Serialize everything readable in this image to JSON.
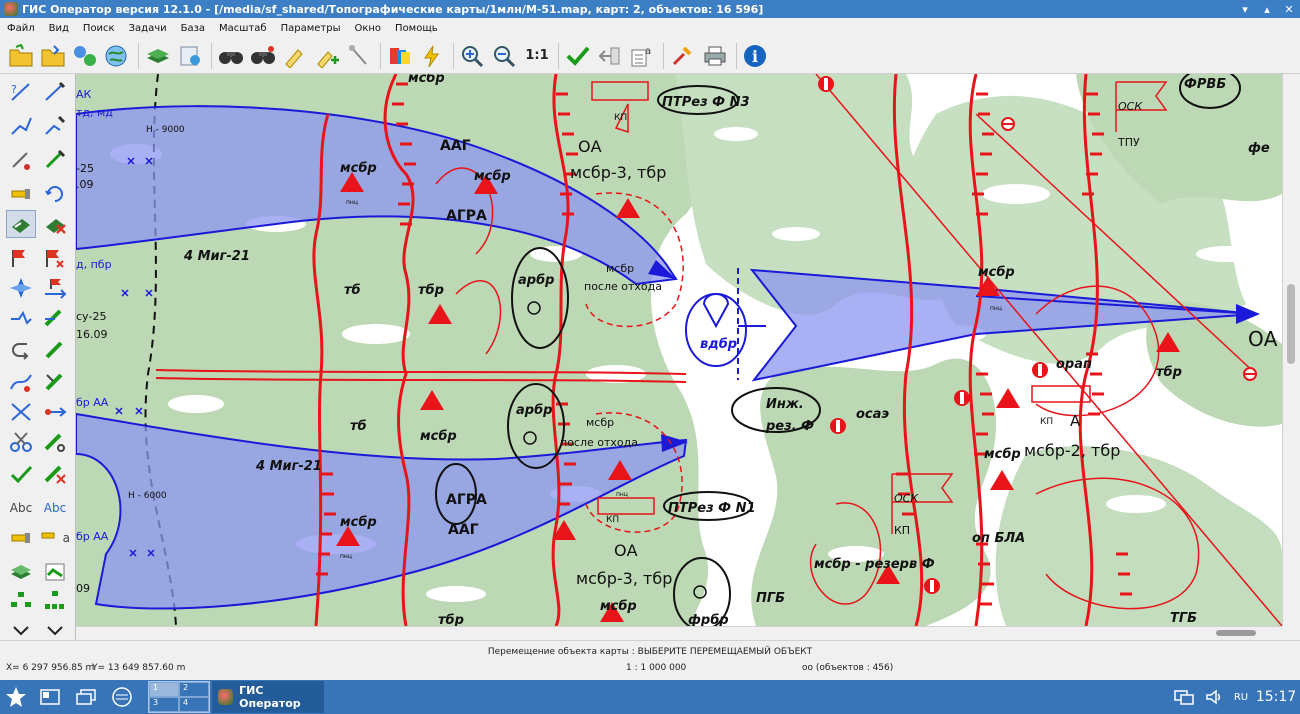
{
  "window": {
    "title": "ГИС Оператор версия 12.1.0 - [/media/sf_shared/Топографические карты/1млн/M-51.map, карт: 2, объектов: 16 596]",
    "buttons": [
      "▾",
      "▴",
      "✕"
    ]
  },
  "menu": [
    "Файл",
    "Вид",
    "Поиск",
    "Задачи",
    "База",
    "Масштаб",
    "Параметры",
    "Окно",
    "Помощь"
  ],
  "toolbar": {
    "scale_button_label": "1:1",
    "icons": [
      "open-folder-icon",
      "save-folder-icon",
      "network-icon",
      "globe-icon",
      "layers-icon",
      "database-icon",
      "binoculars-icon",
      "binoculars-2-icon",
      "brush-icon",
      "add-object-icon",
      "pin-icon",
      "color-palette-icon",
      "lightning-icon",
      "zoom-in-icon",
      "zoom-out-icon",
      "scale-1-1-icon",
      "check-icon",
      "back-icon",
      "text-icon",
      "tools-icon",
      "printer-icon",
      "info-icon"
    ]
  },
  "lefttools": {
    "abc_label": "Abc",
    "abc2_label": "Abc",
    "a_label": "a"
  },
  "map": {
    "labels": {
      "ptrez_n3": "ПТРез Ф N3",
      "ptrez_n1": "ПТРез Ф N1",
      "frvb": "ФРВБ",
      "osk1": "ОСК",
      "tpu": "ТПУ",
      "fe": "фе",
      "aag1": "ААГ",
      "aag2": "ААГ",
      "agra1": "АГРА",
      "agra2": "АГРА",
      "msbr": "мсбр",
      "oa1": "ОА",
      "oa2": "ОА",
      "oa3": "ОА",
      "msbr3_tbr1": "мсбр-3, тбр",
      "msbr3_tbr2": "мсбр-3, тбр",
      "msbr2_tbr": "мсбр-2, тбр",
      "mig21_1": "4 Миг-21",
      "mig21_2": "4 Миг-21",
      "tb": "тб",
      "tbr": "тбр",
      "arbr": "арбр",
      "posle_othoda": "после отхода",
      "vdbr": "вдбр",
      "inzh": "Инж.",
      "rez_f": "рез. Ф",
      "osaz": "осаэ",
      "orap": "орап",
      "kp": "КП",
      "a": "А",
      "op_bla": "оп БЛА",
      "msbr_rezerv": "мсбр - резерв Ф",
      "pgb": "ПГБ",
      "tgb": "ТГБ",
      "frbr": "фрбр",
      "h9000": "Н - 9000",
      "h6000": "Н - 6000",
      "left_ak": "АК",
      "left_td_md": "тд, мд",
      "left_25": "-25",
      "left_09": ".09",
      "left_d_pbr": "д, пбр",
      "left_su25": "су-25",
      "left_1609": "16.09",
      "left_br_aa1": "бр АА",
      "left_br_aa2": "бр АА",
      "left_09b": "09",
      "pnc": "пнц"
    }
  },
  "statusbar": {
    "message": "Перемещение объекта карты : ВЫБЕРИТЕ ПЕРЕМЕЩАЕМЫЙ ОБЪЕКТ",
    "x": "X= 6 297 956.85 m",
    "y": "Y= 13 649 857.60 m",
    "scale": "1 : 1 000 000",
    "objects": "оо   (объектов : 456)"
  },
  "taskbar": {
    "app_label": "ГИС Оператор",
    "desktops": [
      "1",
      "2",
      "3",
      "4"
    ],
    "lang": "RU",
    "time": "15:17"
  },
  "colors": {
    "titlebar": "#3c7fc4",
    "taskbar": "#3774b8",
    "map_forest": "#bcd8b4",
    "tactical_red": "#e8141a",
    "tactical_blue": "#1a1ad8",
    "arrow_fill": "#8c96f0"
  }
}
